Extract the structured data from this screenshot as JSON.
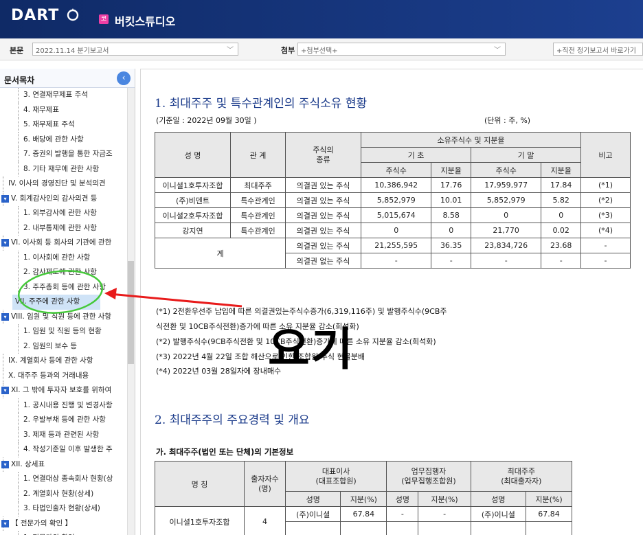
{
  "header": {
    "logo": "DART",
    "company_badge": "코",
    "company_name": "버킷스튜디오"
  },
  "selectbar": {
    "main_label": "본문",
    "main_value": "2022.11.14  분기보고서",
    "attach_label": "첨부",
    "attach_value": "+첨부선택+",
    "prev_value": "+직전 정기보고서 바로가기"
  },
  "sidebar": {
    "title": "문서목차",
    "items": [
      {
        "label": "3. 연결재무제표 주석",
        "level": 2
      },
      {
        "label": "4. 재무제표",
        "level": 2
      },
      {
        "label": "5. 재무제표 주석",
        "level": 2
      },
      {
        "label": "6. 배당에 관한 사항",
        "level": 2
      },
      {
        "label": "7. 증권의 발행을 통한 자금조",
        "level": 2
      },
      {
        "label": "8. 기타 재무에 관한 사항",
        "level": 2
      },
      {
        "label": "IV. 이사의 경영진단 및 분석의견",
        "level": 1
      },
      {
        "label": "V. 회계감사인의 감사의견 등",
        "level": 1,
        "box": true
      },
      {
        "label": "1. 외부감사에 관한 사항",
        "level": 2
      },
      {
        "label": "2. 내부통제에 관한 사항",
        "level": 2
      },
      {
        "label": "VI. 이사회 등 회사의 기관에 관한",
        "level": 1,
        "box": true
      },
      {
        "label": "1. 이사회에 관한 사항",
        "level": 2
      },
      {
        "label": "2. 감사제도에 관한 사항",
        "level": 2
      },
      {
        "label": "3. 주주총회 등에 관한 사항",
        "level": 2
      },
      {
        "label": "VII. 주주에 관한 사항",
        "level": 1,
        "selected": true
      },
      {
        "label": "VIII. 임원 및 직원 등에 관한 사항",
        "level": 1,
        "box": true
      },
      {
        "label": "1. 임원 및 직원 등의 현황",
        "level": 2
      },
      {
        "label": "2. 임원의 보수 등",
        "level": 2
      },
      {
        "label": "IX. 계열회사 등에 관한 사항",
        "level": 1
      },
      {
        "label": "X. 대주주 등과의 거래내용",
        "level": 1
      },
      {
        "label": "XI. 그 밖에 투자자 보호를 위하여",
        "level": 1,
        "box": true
      },
      {
        "label": "1. 공시내용 진행 및 변경사항",
        "level": 2
      },
      {
        "label": "2. 우발부채 등에 관한 사항",
        "level": 2
      },
      {
        "label": "3. 제재 등과 관련된 사항",
        "level": 2
      },
      {
        "label": "4. 작성기준일 이후 발생한 주",
        "level": 2
      },
      {
        "label": "XII. 상세표",
        "level": 1,
        "box": true
      },
      {
        "label": "1. 연결대상 종속회사 현황(상",
        "level": 2
      },
      {
        "label": "2. 계열회사 현황(상세)",
        "level": 2
      },
      {
        "label": "3. 타법인출자 현황(상세)",
        "level": 2
      },
      {
        "label": "【 전문가의 확인 】",
        "level": 1,
        "box": true
      },
      {
        "label": "1. 전문가의 확인",
        "level": 2
      }
    ]
  },
  "section1": {
    "title": "1. 최대주주 및 특수관계인의 주식소유 현황",
    "base_date": "(기준일 :      2022년 09월 30일    )",
    "unit": "(단위 : 주, %)",
    "headers": {
      "name": "성 명",
      "relation": "관 계",
      "stock_type": "주식의\n종류",
      "holdings": "소유주식수 및 지분율",
      "begin": "기 초",
      "end": "기 말",
      "shares": "주식수",
      "ratio": "지분율",
      "remark": "비고"
    },
    "rows": [
      {
        "name": "이니셜1호투자조합",
        "relation": "최대주주",
        "type": "의결권 있는 주식",
        "b_sh": "10,386,942",
        "b_r": "17.76",
        "e_sh": "17,959,977",
        "e_r": "17.84",
        "remark": "(*1)"
      },
      {
        "name": "(주)비덴트",
        "relation": "특수관계인",
        "type": "의결권 있는 주식",
        "b_sh": "5,852,979",
        "b_r": "10.01",
        "e_sh": "5,852,979",
        "e_r": "5.82",
        "remark": "(*2)"
      },
      {
        "name": "이니셜2호투자조합",
        "relation": "특수관계인",
        "type": "의결권 있는 주식",
        "b_sh": "5,015,674",
        "b_r": "8.58",
        "e_sh": "0",
        "e_r": "0",
        "remark": "(*3)"
      },
      {
        "name": "강지연",
        "relation": "특수관계인",
        "type": "의결권 있는 주식",
        "b_sh": "0",
        "b_r": "0",
        "e_sh": "21,770",
        "e_r": "0.02",
        "remark": "(*4)"
      }
    ],
    "total": {
      "label": "계",
      "row1": {
        "type": "의결권 있는 주식",
        "b_sh": "21,255,595",
        "b_r": "36.35",
        "e_sh": "23,834,726",
        "e_r": "23.68",
        "remark": "-"
      },
      "row2": {
        "type": "의결권 없는 주식",
        "b_sh": "-",
        "b_r": "-",
        "e_sh": "-",
        "e_r": "-",
        "remark": "-"
      }
    },
    "notes": [
      "(*1) 2전환우선주 납입에 따른 의결권있는주식수증가(6,319,116주) 및 발행주식수(9CB주",
      "식전환 및 10CB주식전환)증가에 따른 소유 지분율 감소(희석화)",
      "(*2) 발행주식수(9CB주식전환 및 10CB주식전환)증가에 따른 소유 지분율 감소(희석화)",
      "(*3) 2022년 4월 22일 조합 해산으로 인한 조합원 주식 현물분배",
      "(*4) 2022년 03월 28일자에 장내매수"
    ]
  },
  "section2": {
    "title": "2. 최대주주의 주요경력 및 개요",
    "subtitle": "가. 최대주주(법인 또는 단체)의 기본정보",
    "headers": {
      "name": "명 칭",
      "investors": "출자자수\n(명)",
      "rep": "대표이사\n(대표조합원)",
      "exec": "업무집행자\n(업무집행조합원)",
      "largest": "최대주주\n(최대출자자)",
      "person": "성명",
      "stake": "지분(%)"
    },
    "row": {
      "name": "이니셜1호투자조합",
      "investors": "4",
      "rep_name": "(주)이니셜",
      "rep_stake": "67.84",
      "exec_name": "-",
      "exec_stake": "-",
      "lg_name": "(주)이니셜",
      "lg_stake": "67.84"
    }
  },
  "overlay": {
    "text": "요기"
  },
  "colors": {
    "header_bg": "#0f2a66",
    "selected_bg": "#cfe3f7",
    "annotation_green": "#45c93a",
    "annotation_red": "#e81b1b",
    "section_title": "#1a3a8a"
  }
}
